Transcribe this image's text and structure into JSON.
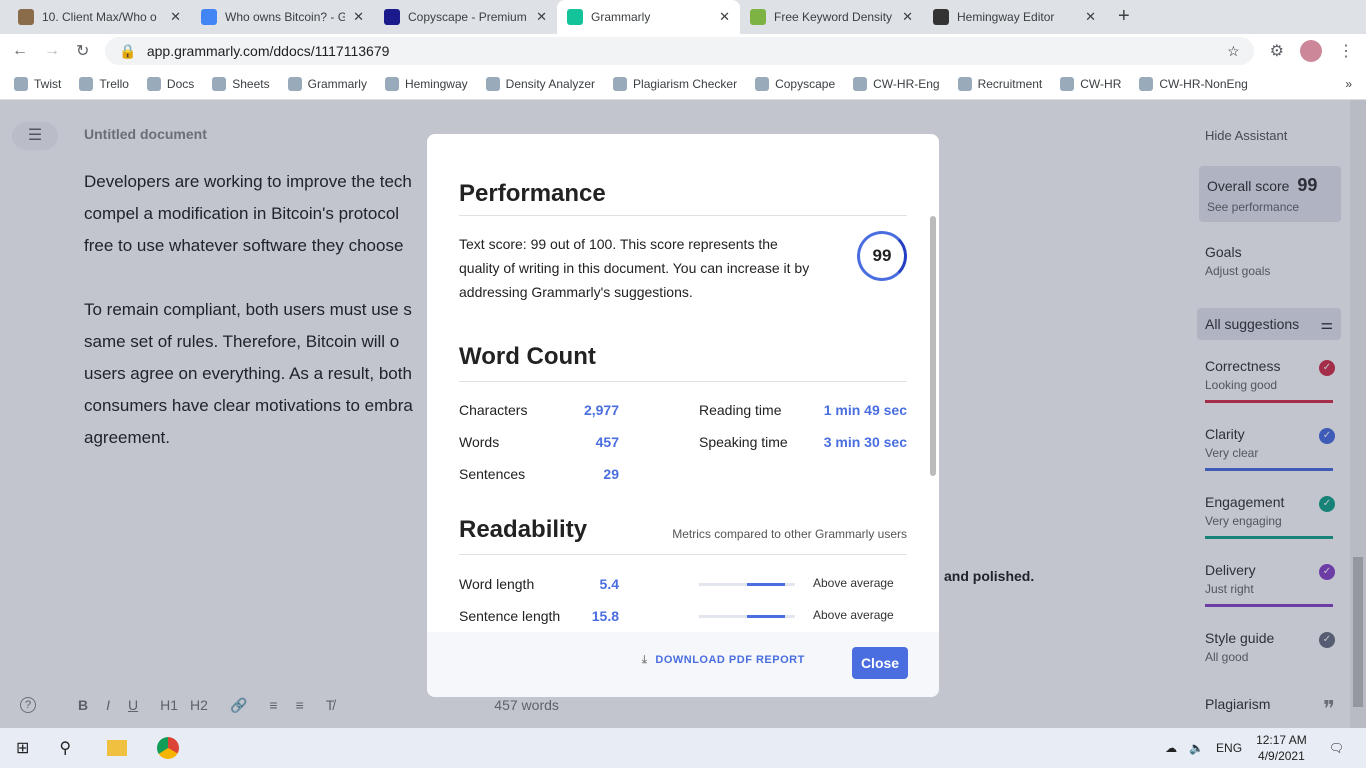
{
  "browser": {
    "tabs": [
      {
        "title": "10. Client Max/Who o",
        "color": "#8a6b4a"
      },
      {
        "title": "Who owns Bitcoin? - G",
        "color": "#4285f4"
      },
      {
        "title": "Copyscape - Premium",
        "color": "#1a1a8c"
      },
      {
        "title": "Grammarly",
        "color": "#15c39a",
        "active": true
      },
      {
        "title": "Free Keyword Density",
        "color": "#7cb342"
      },
      {
        "title": "Hemingway Editor",
        "color": "#333333"
      }
    ],
    "new_tab": "+",
    "url": "app.grammarly.com/ddocs/1117113679",
    "bookmarks": [
      "Twist",
      "Trello",
      "Docs",
      "Sheets",
      "Grammarly",
      "Hemingway",
      "Density Analyzer",
      "Plagiarism Checker",
      "Copyscape",
      "CW-HR-Eng",
      "Recruitment",
      "CW-HR",
      "CW-HR-NonEng"
    ],
    "more": "»"
  },
  "editor": {
    "title": "Untitled document",
    "paragraphs": [
      [
        "Developers are working to improve the tech",
        "compel a modification in Bitcoin's protocol",
        "free to use whatever software they choose"
      ],
      [
        "To remain compliant, both users must use s",
        "same set of rules. Therefore,  Bitcoin will o",
        "users agree on everything. As a result, both",
        "consumers have clear motivations to embra",
        "agreement."
      ]
    ],
    "behind_modal_text": "and polished.",
    "word_count": "457 words",
    "toolbar": [
      "B",
      "I",
      "U",
      "H1",
      "H2"
    ]
  },
  "assistant": {
    "hide": "Hide Assistant",
    "overall_label": "Overall score",
    "overall_score": "99",
    "see_performance": "See performance",
    "goals": "Goals",
    "adjust_goals": "Adjust goals",
    "all_suggestions": "All suggestions",
    "categories": [
      {
        "name": "Correctness",
        "status": "Looking good",
        "color": "#d6304a"
      },
      {
        "name": "Clarity",
        "status": "Very clear",
        "color": "#4a6ee0"
      },
      {
        "name": "Engagement",
        "status": "Very engaging",
        "color": "#15a38a"
      },
      {
        "name": "Delivery",
        "status": "Just right",
        "color": "#8b45c8"
      },
      {
        "name": "Style guide",
        "status": "All good",
        "color": "#6b7080"
      }
    ],
    "plagiarism": "Plagiarism"
  },
  "modal": {
    "performance_title": "Performance",
    "performance_text": "Text score: 99 out of 100. This score represents the quality of writing in this document. You can increase it by addressing Grammarly's suggestions.",
    "score": "99",
    "word_count_title": "Word Count",
    "stats": [
      {
        "label": "Characters",
        "value": "2,977"
      },
      {
        "label": "Words",
        "value": "457"
      },
      {
        "label": "Sentences",
        "value": "29"
      }
    ],
    "times": [
      {
        "label": "Reading time",
        "value": "1 min 49 sec"
      },
      {
        "label": "Speaking time",
        "value": "3 min 30 sec"
      }
    ],
    "readability_title": "Readability",
    "readability_note": "Metrics compared to other Grammarly users",
    "readability": [
      {
        "label": "Word length",
        "value": "5.4",
        "rating": "Above average"
      },
      {
        "label": "Sentence length",
        "value": "15.8",
        "rating": "Above average"
      }
    ],
    "download": "DOWNLOAD PDF REPORT",
    "close": "Close"
  },
  "taskbar": {
    "time": "12:17 AM",
    "date": "4/9/2021",
    "lang": "ENG"
  }
}
